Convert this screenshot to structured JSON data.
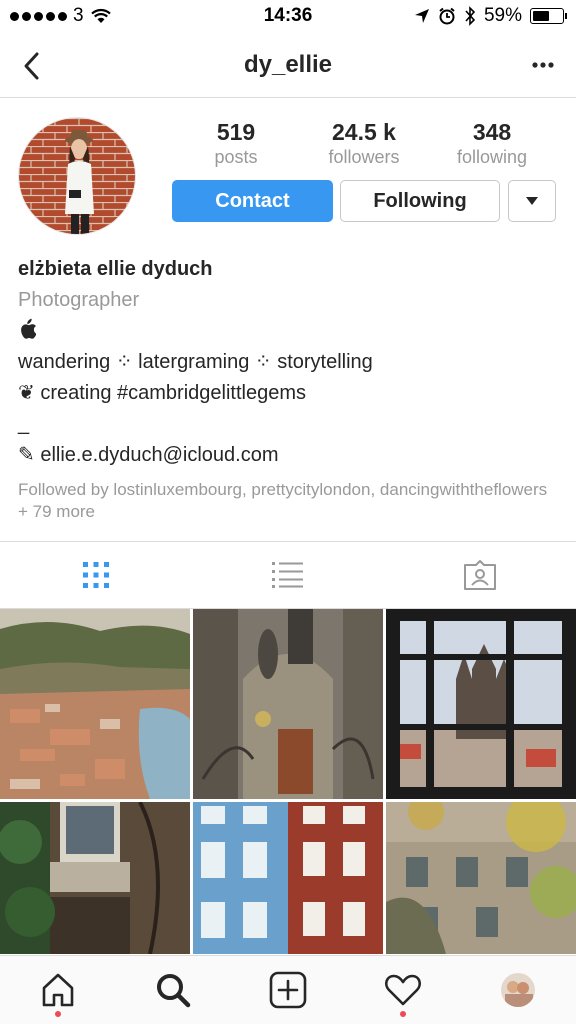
{
  "status_bar": {
    "carrier": "3",
    "time": "14:36",
    "battery": "59%",
    "battery_level": 0.59
  },
  "nav": {
    "title": "dy_ellie"
  },
  "profile": {
    "stats": [
      {
        "value": "519",
        "label": "posts"
      },
      {
        "value": "24.5 k",
        "label": "followers"
      },
      {
        "value": "348",
        "label": "following"
      }
    ],
    "contact_label": "Contact",
    "following_label": "Following"
  },
  "bio": {
    "name": "elżbieta ellie dyduch",
    "category": "Photographer",
    "line_tags": "wandering ⁘ latergraming ⁘ storytelling",
    "line_creating": "❦ creating #cambridgelittlegems",
    "dash": "_",
    "email": "✎ ellie.e.dyduch@icloud.com",
    "followed_by": "Followed by lostinluxembourg, prettycitylondon, dancingwiththeflowers + 79 more"
  },
  "colors": {
    "accent": "#3897f0",
    "muted": "#999999",
    "notification": "#ed4956"
  },
  "icons": {
    "back": "chevron-left-icon",
    "more": "more-dots-icon",
    "grid": "grid-icon",
    "list": "list-icon",
    "tagged": "tagged-icon",
    "home": "home-icon",
    "search": "search-icon",
    "add": "add-icon",
    "activity": "heart-icon",
    "profile": "avatar"
  }
}
